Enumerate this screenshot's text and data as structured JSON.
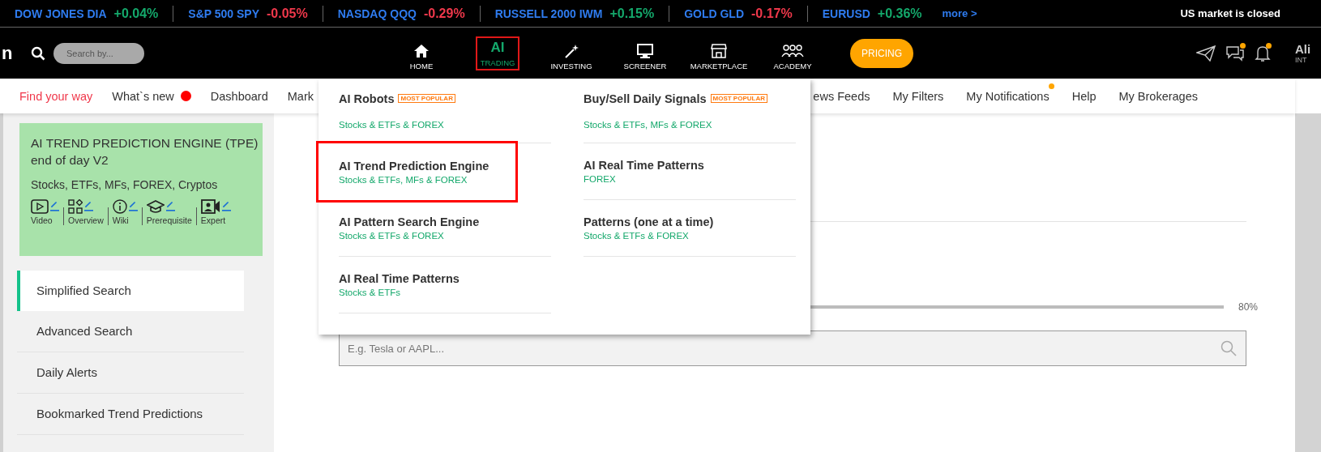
{
  "ticker": {
    "items": [
      {
        "name": "DOW JONES DIA",
        "change": "+0.04%",
        "color": "#14a86b"
      },
      {
        "name": "S&P 500 SPY",
        "change": "-0.05%",
        "color": "#f0384b"
      },
      {
        "name": "NASDAQ QQQ",
        "change": "-0.29%",
        "color": "#f0384b"
      },
      {
        "name": "RUSSELL 2000 IWM",
        "change": "+0.15%",
        "color": "#14a86b"
      },
      {
        "name": "GOLD GLD",
        "change": "-0.17%",
        "color": "#f0384b"
      },
      {
        "name": "EURUSD",
        "change": "+0.36%",
        "color": "#14a86b"
      }
    ],
    "more_link": "more >",
    "market_status": "US market is closed"
  },
  "header": {
    "logo_fragment": "n",
    "search": {
      "placeholder": "Search by..."
    },
    "nav": [
      {
        "kind": "home",
        "label": "HOME",
        "selected": false
      },
      {
        "kind": "ai",
        "badge": "AI",
        "label": "TRADING",
        "selected": true
      },
      {
        "kind": "investing",
        "label": "INVESTING",
        "selected": false
      },
      {
        "kind": "screener",
        "label": "SCREENER",
        "selected": false
      },
      {
        "kind": "marketplace",
        "label": "MARKETPLACE",
        "selected": false
      },
      {
        "kind": "academy",
        "label": "ACADEMY",
        "selected": false
      }
    ],
    "pricing_button": "PRICING",
    "actions": [
      {
        "kind": "send",
        "notification": false
      },
      {
        "kind": "chat",
        "notification": true
      },
      {
        "kind": "bell",
        "notification": true
      }
    ],
    "user": {
      "name": "Ali",
      "subtitle": "INT"
    }
  },
  "subnav": {
    "left": [
      {
        "label": "Find your way",
        "selected": true,
        "notification": false
      },
      {
        "label": "What`s new",
        "selected": false,
        "notification": true
      },
      {
        "label": "Dashboard",
        "selected": false,
        "notification": false
      },
      {
        "label": "Mark",
        "selected": false,
        "notification": false
      }
    ],
    "right": [
      {
        "label": "ews Feeds",
        "selected": false,
        "notification": false
      },
      {
        "label": "My Filters",
        "selected": false,
        "notification": false
      },
      {
        "label": "My Notifications",
        "selected": false,
        "notification": true
      },
      {
        "label": "Help",
        "selected": false,
        "notification": false
      },
      {
        "label": "My Brokerages",
        "selected": false,
        "notification": false
      }
    ]
  },
  "sidebar": {
    "card": {
      "title": "AI TREND PREDICTION ENGINE (TPE) end of day V2",
      "subtitle": "Stocks, ETFs, MFs, FOREX, Cryptos",
      "links": [
        {
          "kind": "video",
          "label": "Video"
        },
        {
          "kind": "overview",
          "label": "Overview"
        },
        {
          "kind": "wiki",
          "label": "Wiki"
        },
        {
          "kind": "prerequisite",
          "label": "Prerequisite"
        },
        {
          "kind": "expert",
          "label": "Expert"
        }
      ]
    },
    "menu": [
      {
        "label": "Simplified Search",
        "selected": true
      },
      {
        "label": "Advanced Search",
        "selected": false
      },
      {
        "label": "Daily Alerts",
        "selected": false
      },
      {
        "label": "Bookmarked Trend Predictions",
        "selected": false
      }
    ]
  },
  "main": {
    "slider": {
      "level": 1,
      "reading": "80%"
    },
    "search": {
      "placeholder": "E.g. Tesla or AAPL..."
    }
  },
  "dropdown": {
    "columns": [
      [
        {
          "title": "AI Robots",
          "badge": "MOST POPULAR",
          "subtitle": "Stocks & ETFs & FOREX",
          "highlighted": false
        },
        {
          "title": "AI Trend Prediction Engine",
          "subtitle": "Stocks & ETFs, MFs & FOREX",
          "highlighted": true
        },
        {
          "title": "AI Pattern Search Engine",
          "subtitle": "Stocks & ETFs & FOREX",
          "highlighted": false
        },
        {
          "title": "AI Real Time Patterns",
          "subtitle": "Stocks & ETFs",
          "highlighted": false
        }
      ],
      [
        {
          "title": "Buy/Sell Daily Signals",
          "badge": "MOST POPULAR",
          "subtitle": "Stocks & ETFs, MFs & FOREX",
          "highlighted": false
        },
        {
          "title": "AI Real Time Patterns",
          "subtitle": "FOREX",
          "highlighted": false
        },
        {
          "title": "Patterns (one at a time)",
          "subtitle": "Stocks & ETFs & FOREX",
          "highlighted": false
        }
      ]
    ]
  }
}
